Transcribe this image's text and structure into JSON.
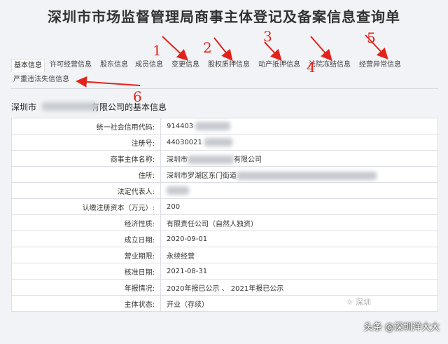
{
  "title": "深圳市市场监督管理局商事主体登记及备案信息查询单",
  "tabs": [
    {
      "label": "基本信息",
      "active": true
    },
    {
      "label": "许可经营信息"
    },
    {
      "label": "股东信息"
    },
    {
      "label": "成员信息"
    },
    {
      "label": "变更信息"
    },
    {
      "label": "股权质押信息"
    },
    {
      "label": "动产抵押信息"
    },
    {
      "label": "法院冻结信息"
    },
    {
      "label": "经营异常信息"
    },
    {
      "label": "严重违法失信信息"
    }
  ],
  "annotations": [
    "1",
    "2",
    "3",
    "4",
    "5",
    "6"
  ],
  "section": {
    "prefix": "深圳市",
    "suffix": "有限公司的基本信息"
  },
  "rows": [
    {
      "label": "统一社会信用代码:",
      "value": "914403"
    },
    {
      "label": "注册号:",
      "value": "44030021"
    },
    {
      "label": "商事主体名称:",
      "value": "深圳市",
      "value_suffix": "有限公司"
    },
    {
      "label": "住所:",
      "value": "深圳市罗湖区东门街道"
    },
    {
      "label": "法定代表人:",
      "value": ""
    },
    {
      "label": "认缴注册资本（万元）:",
      "value": "200"
    },
    {
      "label": "经济性质:",
      "value": "有限责任公司（自然人独资）"
    },
    {
      "label": "成立日期:",
      "value": "2020-09-01"
    },
    {
      "label": "营业期限:",
      "value": "永续经营"
    },
    {
      "label": "核准日期:",
      "value": "2021-08-31"
    },
    {
      "label": "年报情况:",
      "value": "2020年报已公示 、 2021年报已公示"
    },
    {
      "label": "主体状态:",
      "value": "开业（存续）"
    }
  ],
  "watermark": "头条 @深圳洋大大",
  "colors": {
    "annotation": "#e3231b",
    "background": "#f1f3f6"
  }
}
